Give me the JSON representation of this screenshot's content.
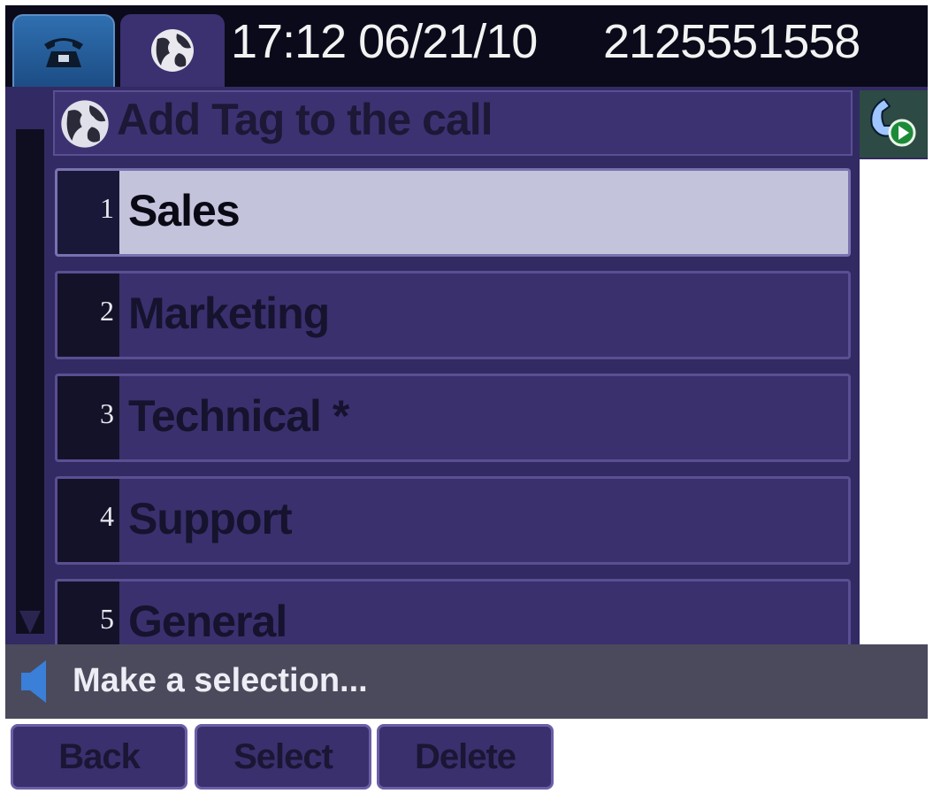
{
  "status": {
    "datetime": "17:12 06/21/10",
    "phone_number": "2125551558",
    "tabs": [
      {
        "icon": "desk-phone-icon",
        "active": true
      },
      {
        "icon": "globe-icon",
        "active": false
      }
    ]
  },
  "header": {
    "icon": "globe-icon",
    "title": "Add Tag to the call",
    "call_indicator_icon": "phone-call-icon"
  },
  "menu": {
    "items": [
      {
        "number": "1",
        "label": "Sales",
        "selected": true
      },
      {
        "number": "2",
        "label": "Marketing",
        "selected": false
      },
      {
        "number": "3",
        "label": "Technical *",
        "selected": false
      },
      {
        "number": "4",
        "label": "Support",
        "selected": false
      },
      {
        "number": "5",
        "label": "General",
        "selected": false
      }
    ]
  },
  "prompt": {
    "icon": "speaker-icon",
    "text": "Make a selection..."
  },
  "softkeys": {
    "back": "Back",
    "select": "Select",
    "delete": "Delete"
  },
  "colors": {
    "background": "#322a62",
    "row": "#3a306e",
    "row_selected": "#c3c3dc",
    "tab_active": "#2f6fb0",
    "prompt_bar": "#4a4a5c"
  }
}
